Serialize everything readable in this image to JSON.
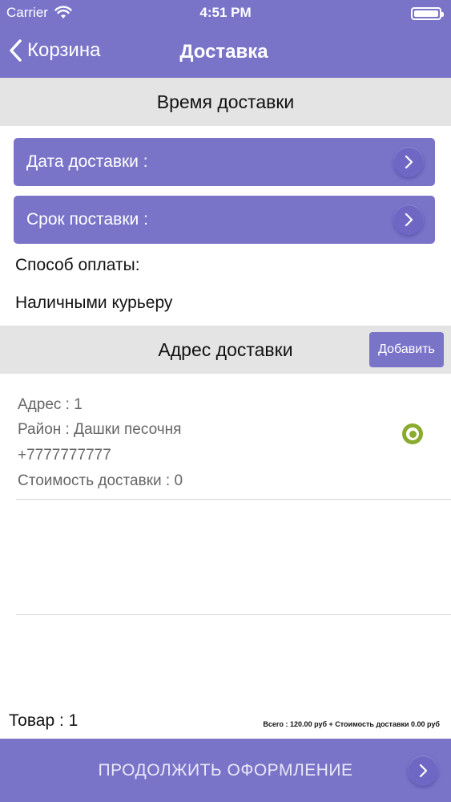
{
  "status_bar": {
    "carrier": "Carrier",
    "time": "4:51 PM",
    "wifi_icon": "wifi-icon",
    "battery_icon": "battery-icon"
  },
  "nav": {
    "back_label": "Корзина",
    "title": "Доставка"
  },
  "delivery_time": {
    "header": "Время доставки",
    "date_label": "Дата доставки :",
    "term_label": "Срок поставки :"
  },
  "payment": {
    "label": "Способ оплаты:",
    "value": "Наличными курьеру"
  },
  "address_section": {
    "header": "Адрес доставки",
    "add_button": "Добавить",
    "card": {
      "address": "Адрес : 1",
      "district": "Район : Дашки песочня",
      "phone": "+7777777777",
      "cost": "Стоимость доставки : 0",
      "selected": true
    }
  },
  "summary": {
    "goods": "Товар : 1",
    "total": "Всего : 120.00 руб + Стоимость доставки 0.00 руб"
  },
  "footer": {
    "continue_label": "ПРОДОЛЖИТЬ ОФОРМЛЕНИЕ"
  },
  "colors": {
    "accent": "#7a74c9",
    "section_bg": "#e4e4e4",
    "radio_selected": "#8bab2f"
  }
}
